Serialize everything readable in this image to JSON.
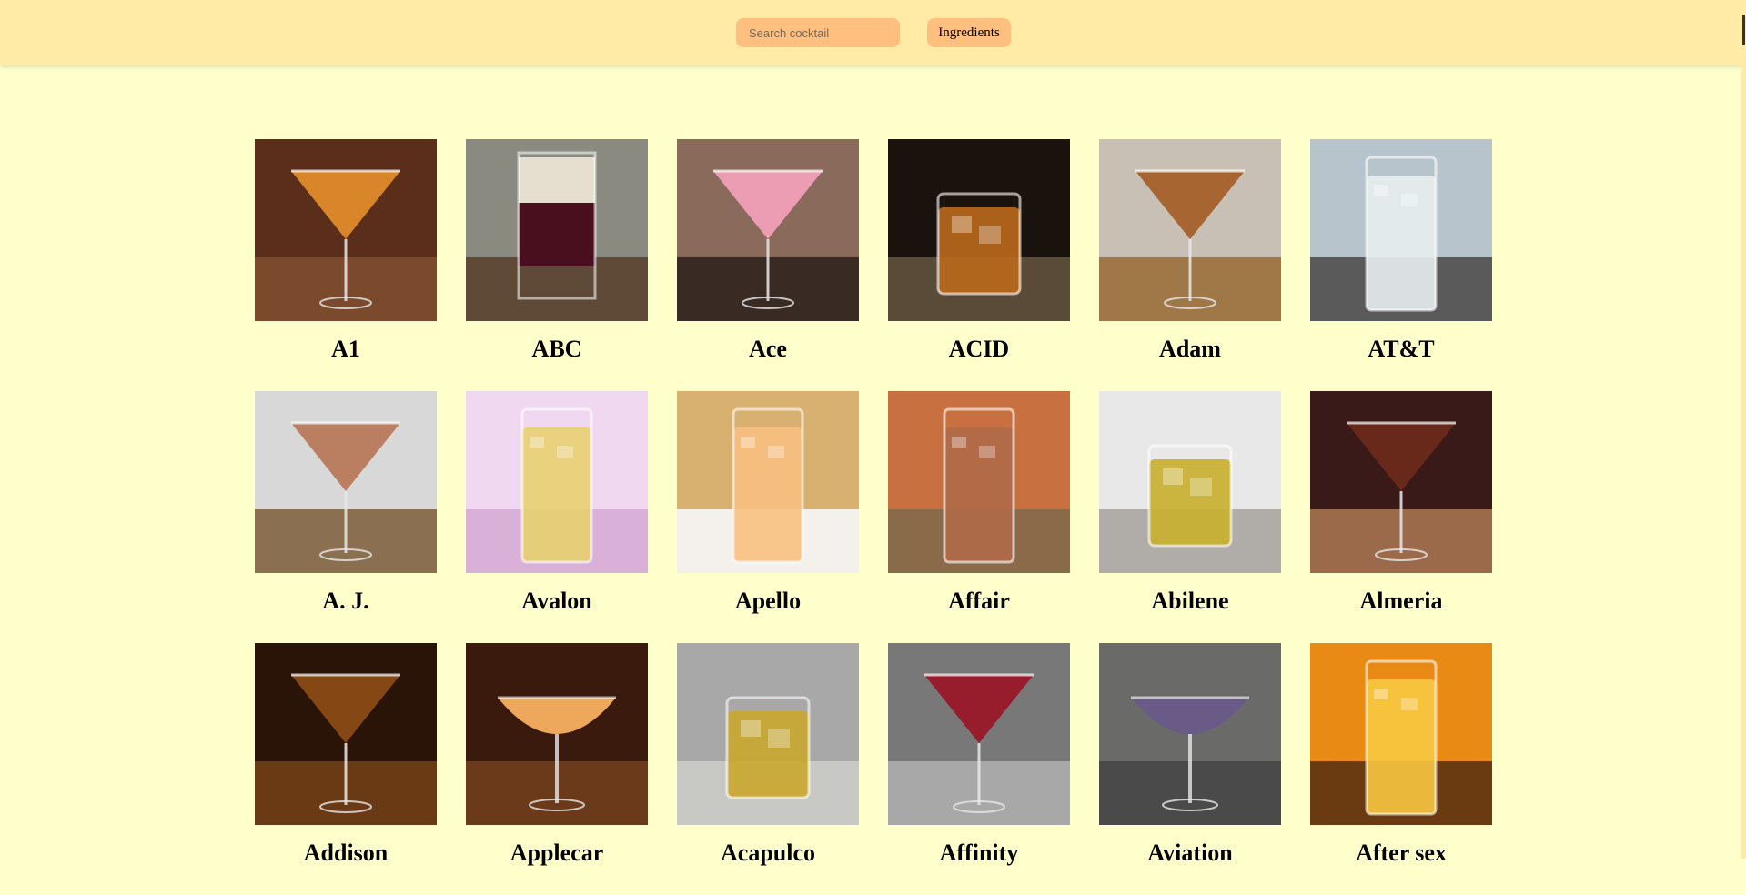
{
  "header": {
    "search_placeholder": "Search cocktail",
    "ingredients_label": "Ingredients"
  },
  "cocktails": [
    {
      "name": "A1",
      "bg": "#5a2e1a",
      "bg2": "#7b4a2c",
      "liquid": "#e08a2a",
      "glass": "martini"
    },
    {
      "name": "ABC",
      "bg": "#8a8a80",
      "bg2": "#5e4a36",
      "liquid": "#4a0f1e",
      "glass": "shot"
    },
    {
      "name": "Ace",
      "bg": "#8a6a5a",
      "bg2": "#3a2a24",
      "liquid": "#f2a0b8",
      "glass": "martini"
    },
    {
      "name": "ACID",
      "bg": "#1a120c",
      "bg2": "#5a4a38",
      "liquid": "#b8681c",
      "glass": "rocks"
    },
    {
      "name": "Adam",
      "bg": "#c8c0b4",
      "bg2": "#a07848",
      "liquid": "#a4602a",
      "glass": "martini"
    },
    {
      "name": "AT&T",
      "bg": "#b8c4cc",
      "bg2": "#5a5a5a",
      "liquid": "#e8eef0",
      "glass": "highball"
    },
    {
      "name": "A. J.",
      "bg": "#d8d8d8",
      "bg2": "#8a7050",
      "liquid": "#b87a5a",
      "glass": "martini"
    },
    {
      "name": "Avalon",
      "bg": "#f0d8f0",
      "bg2": "#d8b0d8",
      "liquid": "#e8d070",
      "glass": "highball"
    },
    {
      "name": "Apello",
      "bg": "#d8b070",
      "bg2": "#f4f0ec",
      "liquid": "#f8c080",
      "glass": "highball"
    },
    {
      "name": "Affair",
      "bg": "#c87040",
      "bg2": "#8a6a48",
      "liquid": "#b06a48",
      "glass": "highball"
    },
    {
      "name": "Abilene",
      "bg": "#e8e8e8",
      "bg2": "#b0aca8",
      "liquid": "#c8b030",
      "glass": "rocks"
    },
    {
      "name": "Almeria",
      "bg": "#3a1a18",
      "bg2": "#9a6a4a",
      "liquid": "#6a2a1a",
      "glass": "martini"
    },
    {
      "name": "Addison",
      "bg": "#2a1408",
      "bg2": "#6a3a14",
      "liquid": "#8a4a14",
      "glass": "martini"
    },
    {
      "name": "Applecar",
      "bg": "#3a1a0c",
      "bg2": "#6a3a1a",
      "liquid": "#f8b060",
      "glass": "coupe"
    },
    {
      "name": "Acapulco",
      "bg": "#a8a8a8",
      "bg2": "#c8c8c4",
      "liquid": "#c8a830",
      "glass": "rocks"
    },
    {
      "name": "Affinity",
      "bg": "#787878",
      "bg2": "#a8a8a8",
      "liquid": "#9a1828",
      "glass": "martini"
    },
    {
      "name": "Aviation",
      "bg": "#6a6a68",
      "bg2": "#4a4a4a",
      "liquid": "#6a5a8a",
      "glass": "coupe"
    },
    {
      "name": "After sex",
      "bg": "#e88a14",
      "bg2": "#6a3a10",
      "liquid": "#f8c840",
      "glass": "highball"
    }
  ]
}
